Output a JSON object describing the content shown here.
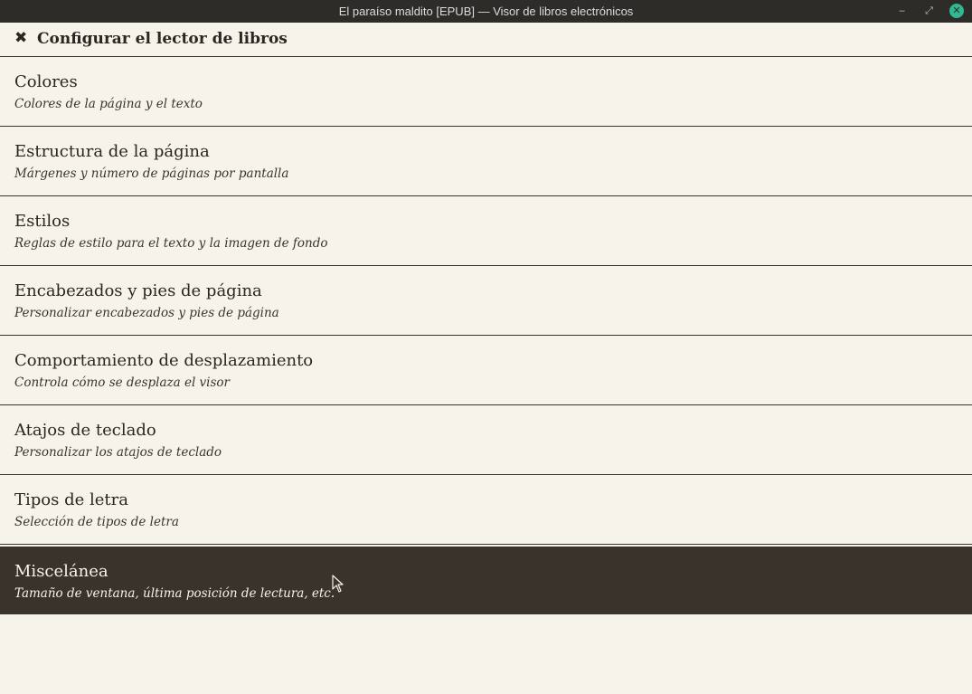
{
  "window": {
    "title": "El paraíso maldito [EPUB] — Visor de libros electrónicos",
    "minimize_glyph": "–",
    "maximize_glyph": "⤢",
    "close_glyph": "✕"
  },
  "header": {
    "close_glyph": "✖",
    "title": "Configurar el lector de libros"
  },
  "items": [
    {
      "name": "Colores",
      "desc": "Colores de la página y el texto"
    },
    {
      "name": "Estructura de la página",
      "desc": "Márgenes y número de páginas por pantalla"
    },
    {
      "name": "Estilos",
      "desc": "Reglas de estilo para el texto y la imagen de fondo"
    },
    {
      "name": "Encabezados y pies de página",
      "desc": "Personalizar encabezados y pies de página"
    },
    {
      "name": "Comportamiento de desplazamiento",
      "desc": "Controla cómo se desplaza el visor"
    },
    {
      "name": "Atajos de teclado",
      "desc": "Personalizar los atajos de teclado"
    },
    {
      "name": "Tipos de letra",
      "desc": "Selección de tipos de letra"
    },
    {
      "name": "Miscelánea",
      "desc": "Tamaño de ventana, última posición de lectura, etc."
    }
  ],
  "colors": {
    "background": "#f6f3ea",
    "selected_background": "#3a332c",
    "titlebar": "#2e2c29",
    "close_button": "#2fb892"
  }
}
